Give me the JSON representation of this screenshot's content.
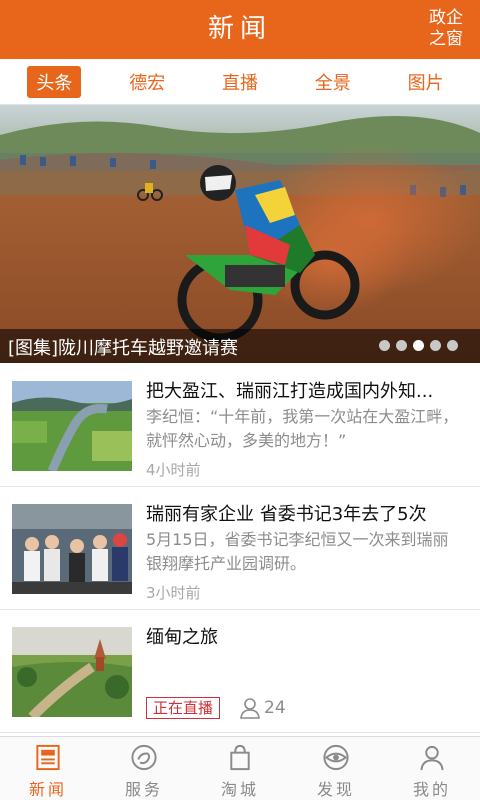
{
  "header": {
    "title": "新闻",
    "right_label": "政企之窗"
  },
  "tabs": [
    {
      "label": "头条",
      "active": true
    },
    {
      "label": "德宏",
      "active": false
    },
    {
      "label": "直播",
      "active": false
    },
    {
      "label": "全景",
      "active": false
    },
    {
      "label": "图片",
      "active": false
    }
  ],
  "banner": {
    "caption": "[图集]陇川摩托车越野邀请赛",
    "dots_total": 5,
    "active_dot": 3
  },
  "news": [
    {
      "title": "把大盈江、瑞丽江打造成国内外知...",
      "summary": "李纪恒：“十年前，我第一次站在大盈江畔，就怦然心动，多美的地方！”",
      "time": "4小时前"
    },
    {
      "title": "瑞丽有家企业 省委书记3年去了5次",
      "summary": "5月15日，省委书记李纪恒又一次来到瑞丽银翔摩托产业园调研。",
      "time": "3小时前"
    },
    {
      "title": "缅甸之旅",
      "badge": "正在直播",
      "viewers": "24"
    }
  ],
  "bottom_nav": [
    {
      "label": "新闻",
      "icon": "newspaper-icon",
      "active": true
    },
    {
      "label": "服务",
      "icon": "service-icon",
      "active": false
    },
    {
      "label": "淘城",
      "icon": "shopping-bag-icon",
      "active": false
    },
    {
      "label": "发现",
      "icon": "eye-icon",
      "active": false
    },
    {
      "label": "我的",
      "icon": "person-icon",
      "active": false
    }
  ],
  "colors": {
    "accent": "#e8661c",
    "live": "#d0303a",
    "muted": "#8c8c8c"
  }
}
